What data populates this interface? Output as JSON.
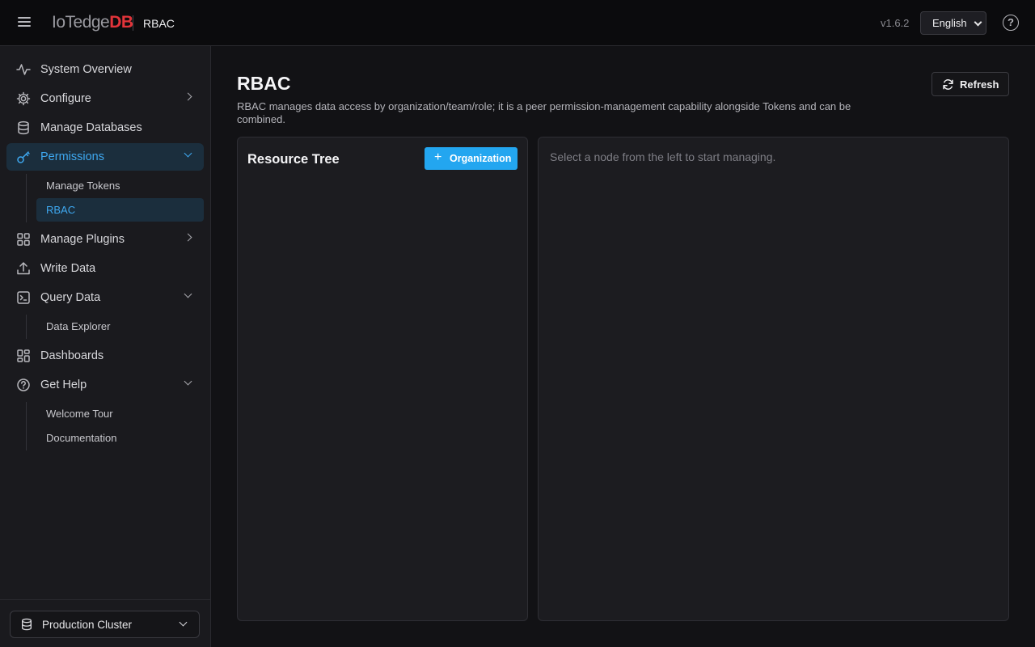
{
  "topbar": {
    "logo_part1": "IoTedge",
    "logo_part2": "DB",
    "crumb": "RBAC",
    "version": "v1.6.2",
    "language": "English",
    "help_symbol": "?"
  },
  "sidebar": {
    "items": [
      {
        "label": "System Overview",
        "icon": "pulse-icon"
      },
      {
        "label": "Configure",
        "icon": "gear-icon"
      },
      {
        "label": "Manage Databases",
        "icon": "database-icon"
      },
      {
        "label": "Permissions",
        "icon": "key-icon",
        "active": true
      },
      {
        "label": "Manage Plugins",
        "icon": "grid-icon"
      },
      {
        "label": "Write Data",
        "icon": "upload-icon"
      },
      {
        "label": "Query Data",
        "icon": "terminal-icon"
      },
      {
        "label": "Dashboards",
        "icon": "dashboard-icon"
      },
      {
        "label": "Get Help",
        "icon": "help-circle-icon"
      }
    ],
    "permissions_sub": [
      "Manage Tokens",
      "RBAC"
    ],
    "query_sub": [
      "Data Explorer"
    ],
    "help_sub": [
      "Welcome Tour",
      "Documentation"
    ],
    "cluster": "Production Cluster"
  },
  "main": {
    "title": "RBAC",
    "description": "RBAC manages data access by organization/team/role; it is a peer permission-management capability alongside Tokens and can be combined.",
    "refresh_label": "Refresh",
    "tree_title": "Resource Tree",
    "add_org_label": "Organization",
    "add_org_symbol": "+",
    "empty_hint": "Select a node from the left to start managing."
  },
  "colors": {
    "accent": "#23a6f0",
    "active_text": "#3ea8f0",
    "brand_red": "#e2343a",
    "background": "#121215",
    "sidebar_bg": "#1a1a1e"
  }
}
